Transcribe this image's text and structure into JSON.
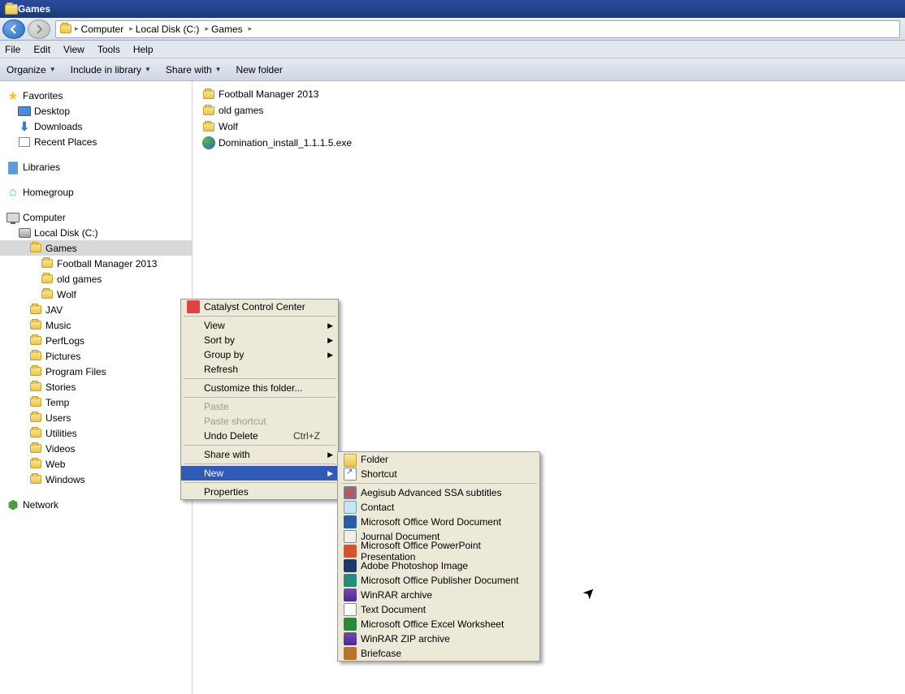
{
  "window": {
    "title": "Games"
  },
  "breadcrumb": [
    "Computer",
    "Local Disk (C:)",
    "Games"
  ],
  "menubar": [
    "File",
    "Edit",
    "View",
    "Tools",
    "Help"
  ],
  "toolbar": {
    "organize": "Organize",
    "include": "Include in library",
    "share": "Share with",
    "new": "New folder"
  },
  "sidebar": {
    "favorites": {
      "label": "Favorites",
      "items": [
        "Desktop",
        "Downloads",
        "Recent Places"
      ]
    },
    "libraries": {
      "label": "Libraries"
    },
    "homegroup": {
      "label": "Homegroup"
    },
    "computer": {
      "label": "Computer"
    },
    "disk": {
      "label": "Local Disk (C:)"
    },
    "games_folder": {
      "label": "Games"
    },
    "games_children": [
      "Football Manager 2013",
      "old games",
      "Wolf"
    ],
    "disk_children": [
      "JAV",
      "Music",
      "PerfLogs",
      "Pictures",
      "Program Files",
      "Stories",
      "Temp",
      "Users",
      "Utilities",
      "Videos",
      "Web",
      "Windows"
    ],
    "network": {
      "label": "Network"
    }
  },
  "files": [
    {
      "name": "Football Manager 2013",
      "type": "folder"
    },
    {
      "name": "old games",
      "type": "folder"
    },
    {
      "name": "Wolf",
      "type": "folder"
    },
    {
      "name": "Domination_install_1.1.1.5.exe",
      "type": "exe"
    }
  ],
  "ctx_main": {
    "catalyst": "Catalyst Control Center",
    "view": "View",
    "sort": "Sort by",
    "group": "Group by",
    "refresh": "Refresh",
    "customize": "Customize this folder...",
    "paste": "Paste",
    "paste_sc": "Paste shortcut",
    "undo": "Undo Delete",
    "undo_key": "Ctrl+Z",
    "share": "Share with",
    "new": "New",
    "props": "Properties"
  },
  "ctx_new": [
    {
      "icon": "folder",
      "label": "Folder"
    },
    {
      "icon": "shortcut",
      "label": "Shortcut"
    },
    {
      "sep": true
    },
    {
      "icon": "aegis",
      "label": "Aegisub Advanced SSA subtitles"
    },
    {
      "icon": "contact",
      "label": "Contact"
    },
    {
      "icon": "word",
      "label": "Microsoft Office Word Document"
    },
    {
      "icon": "journal",
      "label": "Journal Document"
    },
    {
      "icon": "ppt",
      "label": "Microsoft Office PowerPoint Presentation"
    },
    {
      "icon": "ps",
      "label": "Adobe Photoshop Image"
    },
    {
      "icon": "pub",
      "label": "Microsoft Office Publisher Document"
    },
    {
      "icon": "rar",
      "label": "WinRAR archive"
    },
    {
      "icon": "txt",
      "label": "Text Document"
    },
    {
      "icon": "xls",
      "label": "Microsoft Office Excel Worksheet"
    },
    {
      "icon": "rar",
      "label": "WinRAR ZIP archive"
    },
    {
      "icon": "brief",
      "label": "Briefcase"
    }
  ]
}
